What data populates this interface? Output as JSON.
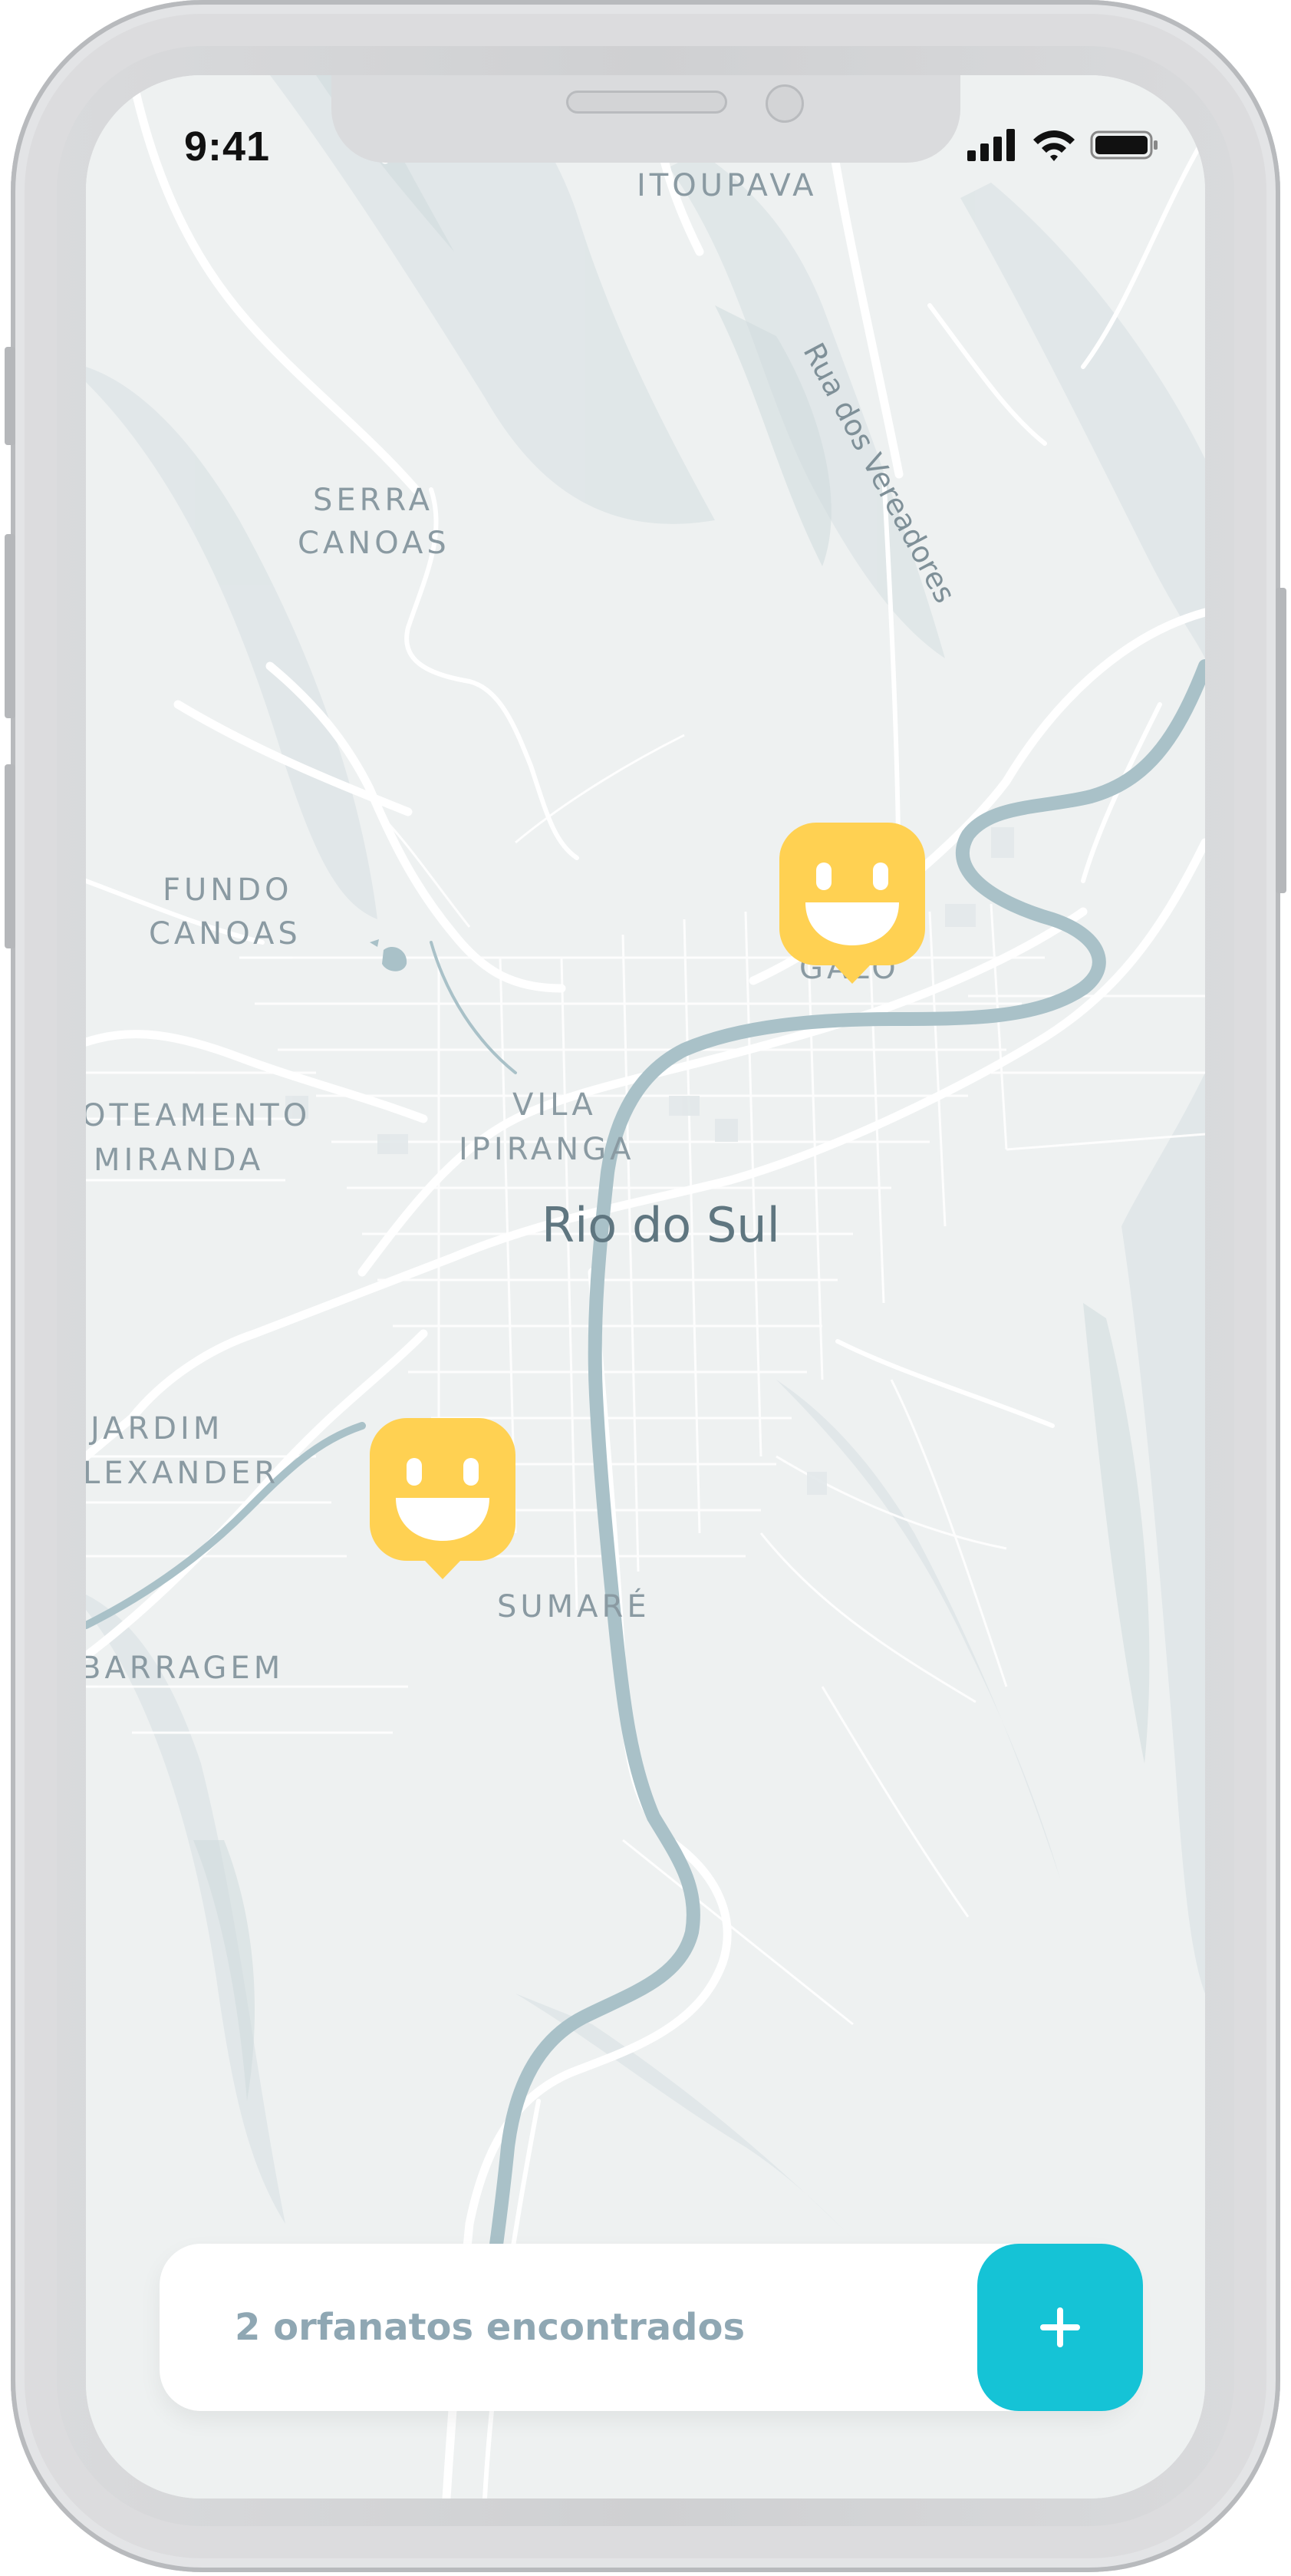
{
  "status_bar": {
    "time": "9:41"
  },
  "map": {
    "neighborhood_labels": [
      "ITOUPAVA",
      "SERRA",
      "CANOAS",
      "FUNDO",
      "CANOAS",
      "VILA",
      "IPIRANGA",
      "OTEAMENTO",
      "MIRANDA",
      "JARDIM",
      "LEXANDER",
      "SUMARÉ",
      "BARRAGEM",
      "GALO"
    ],
    "city_label": "Rio do Sul",
    "street_label": "Rua dos Vereadores",
    "marker_icon": "smiley-marker-icon",
    "marker_color": "#ffd152",
    "river_color": "#a9c1c8"
  },
  "footer": {
    "count_text": "2 orfanatos encontrados",
    "add_button_label": "+",
    "add_button_color": "#15c3d6"
  }
}
